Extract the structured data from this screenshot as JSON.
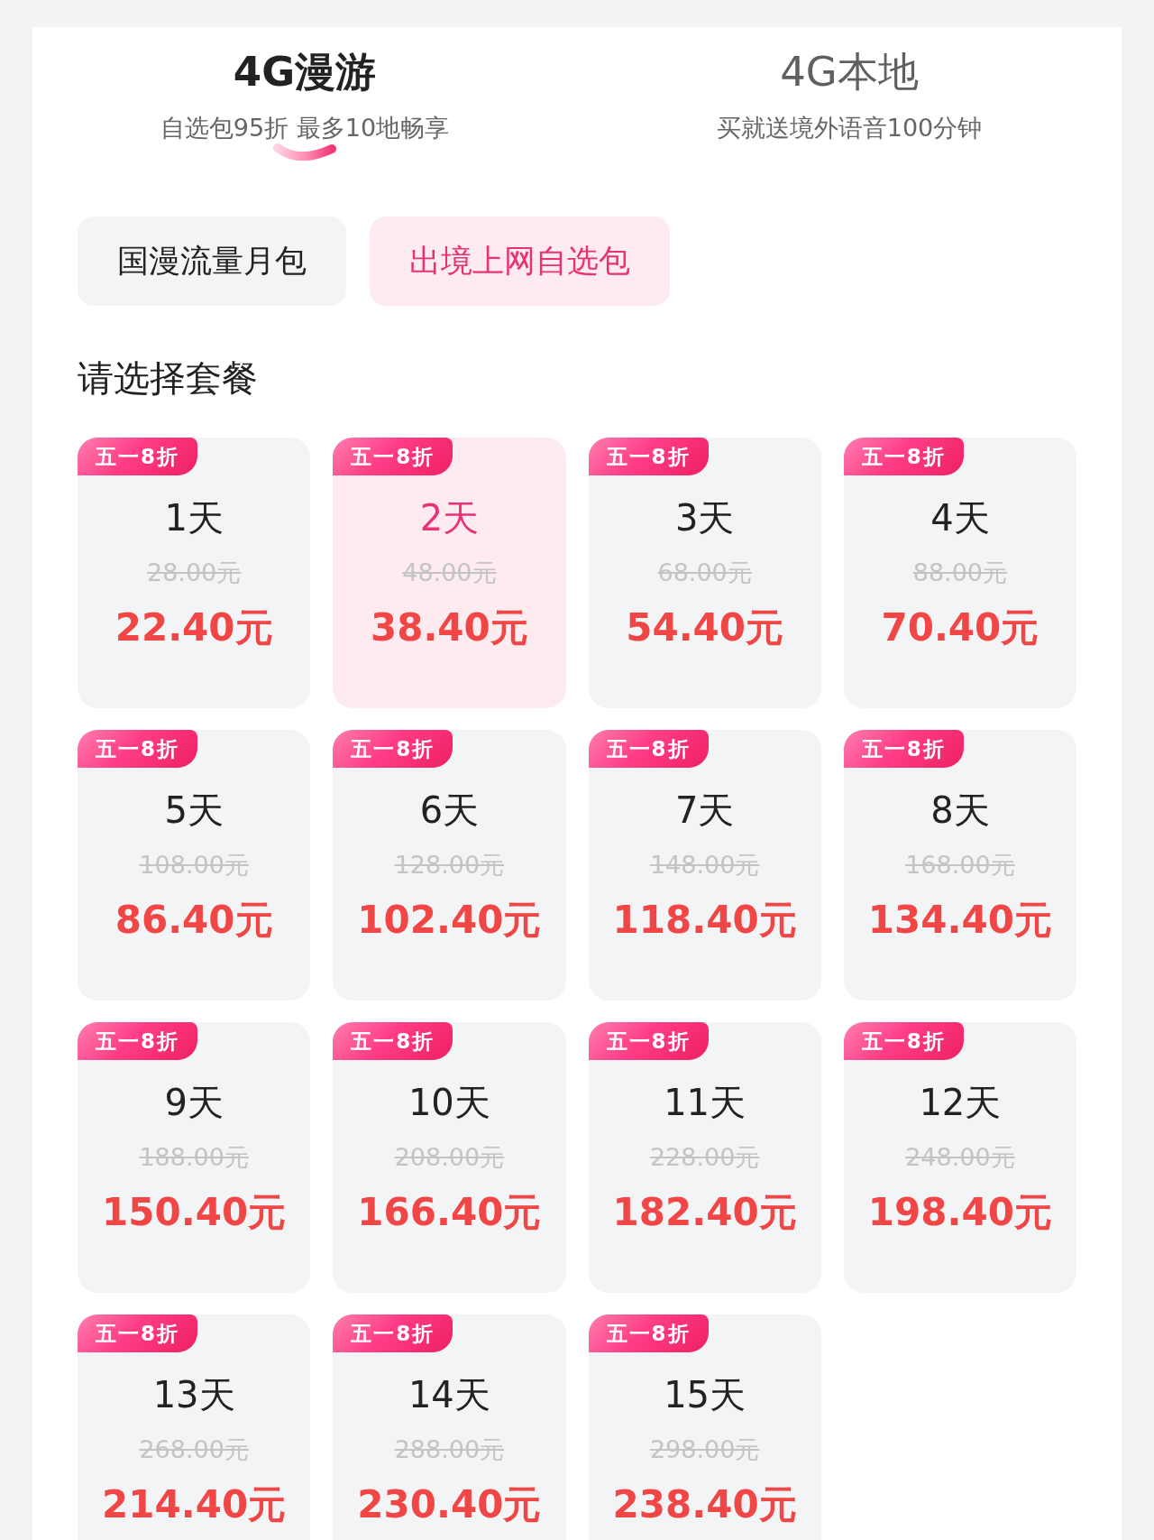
{
  "top_tabs": [
    {
      "title": "4G漫游",
      "subtitle": "自选包95折 最多10地畅享",
      "selected": true
    },
    {
      "title": "4G本地",
      "subtitle": "买就送境外语音100分钟",
      "selected": false
    }
  ],
  "categories": [
    {
      "label": "国漫流量月包",
      "selected": false
    },
    {
      "label": "出境上网自选包",
      "selected": true
    }
  ],
  "section_title": "请选择套餐",
  "plans": [
    {
      "badge": "五一8折",
      "duration": "1天",
      "original_price": "28.00元",
      "price": "22.40元",
      "selected": false
    },
    {
      "badge": "五一8折",
      "duration": "2天",
      "original_price": "48.00元",
      "price": "38.40元",
      "selected": true
    },
    {
      "badge": "五一8折",
      "duration": "3天",
      "original_price": "68.00元",
      "price": "54.40元",
      "selected": false
    },
    {
      "badge": "五一8折",
      "duration": "4天",
      "original_price": "88.00元",
      "price": "70.40元",
      "selected": false
    },
    {
      "badge": "五一8折",
      "duration": "5天",
      "original_price": "108.00元",
      "price": "86.40元",
      "selected": false
    },
    {
      "badge": "五一8折",
      "duration": "6天",
      "original_price": "128.00元",
      "price": "102.40元",
      "selected": false
    },
    {
      "badge": "五一8折",
      "duration": "7天",
      "original_price": "148.00元",
      "price": "118.40元",
      "selected": false
    },
    {
      "badge": "五一8折",
      "duration": "8天",
      "original_price": "168.00元",
      "price": "134.40元",
      "selected": false
    },
    {
      "badge": "五一8折",
      "duration": "9天",
      "original_price": "188.00元",
      "price": "150.40元",
      "selected": false
    },
    {
      "badge": "五一8折",
      "duration": "10天",
      "original_price": "208.00元",
      "price": "166.40元",
      "selected": false
    },
    {
      "badge": "五一8折",
      "duration": "11天",
      "original_price": "228.00元",
      "price": "182.40元",
      "selected": false
    },
    {
      "badge": "五一8折",
      "duration": "12天",
      "original_price": "248.00元",
      "price": "198.40元",
      "selected": false
    },
    {
      "badge": "五一8折",
      "duration": "13天",
      "original_price": "268.00元",
      "price": "214.40元",
      "selected": false
    },
    {
      "badge": "五一8折",
      "duration": "14天",
      "original_price": "288.00元",
      "price": "230.40元",
      "selected": false
    },
    {
      "badge": "五一8折",
      "duration": "15天",
      "original_price": "298.00元",
      "price": "238.40元",
      "selected": false
    }
  ]
}
